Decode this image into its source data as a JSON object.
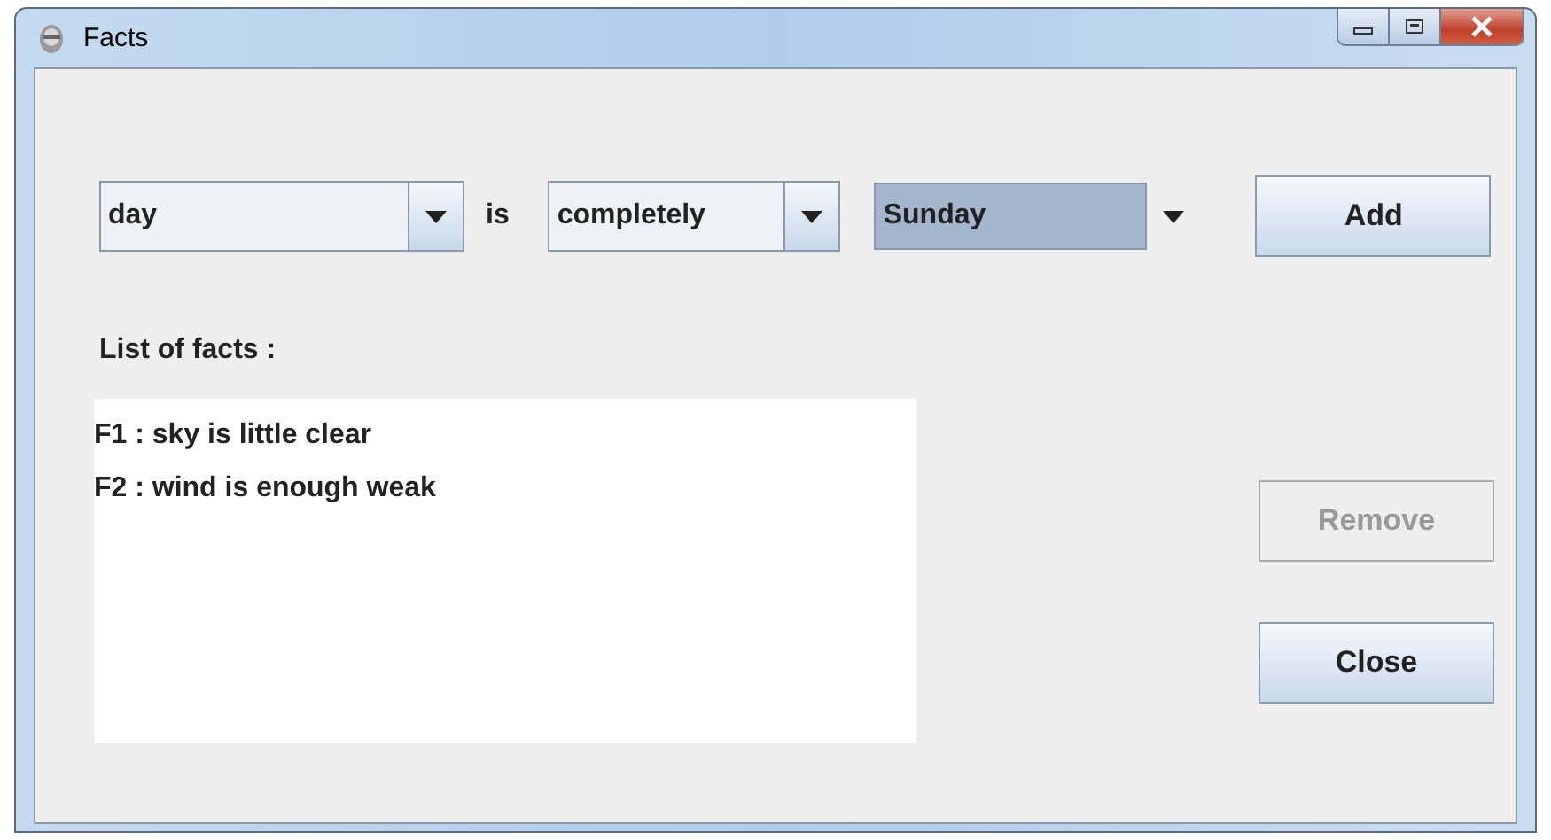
{
  "window": {
    "title": "Facts"
  },
  "selectors": [
    {
      "value": "day",
      "focused": false
    },
    {
      "kind": "text",
      "text": "is"
    },
    {
      "value": "completely",
      "focused": false
    },
    {
      "value": "Sunday",
      "focused": true
    }
  ],
  "add_button": {
    "label": "Add",
    "disabled": false
  },
  "list_label": "List of facts :",
  "facts": [
    "F1 : sky is little clear",
    "F2 : wind is enough weak"
  ],
  "buttons": [
    {
      "label": "Remove",
      "disabled": true
    },
    {
      "label": "Close",
      "disabled": false
    }
  ]
}
